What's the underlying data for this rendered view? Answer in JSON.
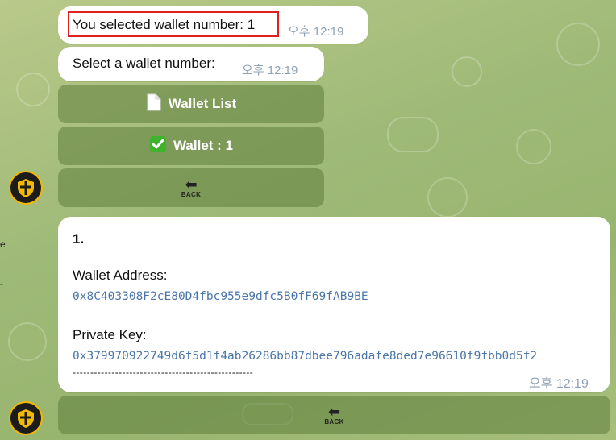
{
  "colors": {
    "bubble": "#ffffff",
    "time": "#8fa2b3",
    "address": "#4a76a8",
    "highlight_border": "#e11f1f",
    "keyboard_button": "#5f7d3c",
    "avatar_ring": "#f5b800"
  },
  "messages": {
    "selected": {
      "text": "You selected wallet number: 1",
      "time": "오후 12:19"
    },
    "select_prompt": {
      "text": "Select a wallet number:",
      "time": "오후 12:19"
    },
    "wallet_info": {
      "index": "1.",
      "address_label": "Wallet Address:",
      "address": "0x8C403308F2cE80D4fbc955e9dfc5B0fF69fAB9BE",
      "private_key_label": "Private Key:",
      "private_key": "0x379970922749d6f5d1f4ab26286bb87dbee796adafe8ded7e96610f9fbb0d5f2",
      "separator": "---------------------------------------------------",
      "time": "오후 12:19"
    }
  },
  "keyboard1": {
    "wallet_list": {
      "icon": "document-icon",
      "label": "Wallet List"
    },
    "wallet_selected": {
      "icon": "check-mark-icon",
      "label": "Wallet : 1"
    },
    "back": {
      "icon": "back-arrow-icon",
      "label": "BACK"
    }
  },
  "keyboard2": {
    "back": {
      "icon": "back-arrow-icon",
      "label": "BACK"
    }
  },
  "edge_glyphs": [
    "e",
    "-"
  ]
}
